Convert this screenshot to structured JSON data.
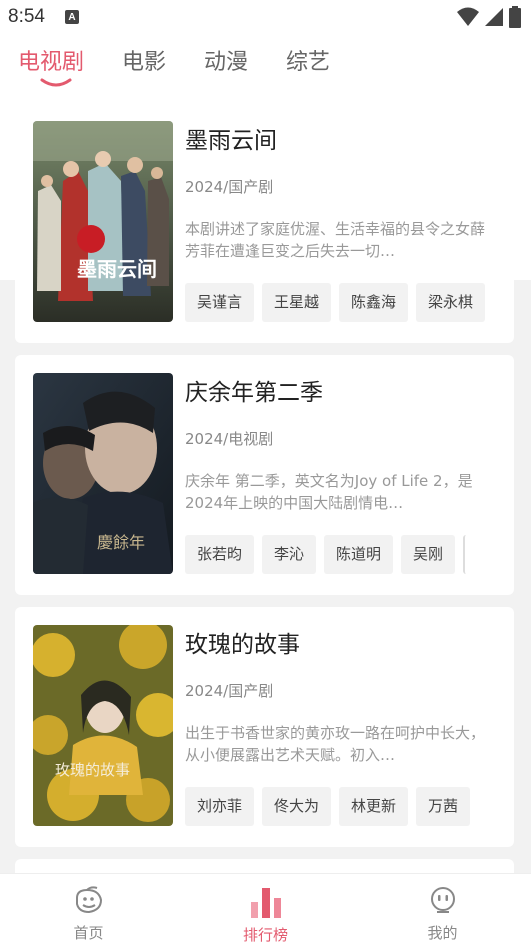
{
  "status_bar": {
    "time": "8:54",
    "notification_icon": "A"
  },
  "tabs": [
    {
      "label": "电视剧",
      "active": true
    },
    {
      "label": "电影",
      "active": false
    },
    {
      "label": "动漫",
      "active": false
    },
    {
      "label": "综艺",
      "active": false
    }
  ],
  "shows": [
    {
      "title": "墨雨云间",
      "meta": "2024/国产剧",
      "desc": "本剧讲述了家庭优渥、生活幸福的县令之女薛芳菲在遭逢巨变之后失去一切…",
      "cast": [
        "吴谨言",
        "王星越",
        "陈鑫海",
        "梁永棋"
      ],
      "poster_text": "墨雨云间"
    },
    {
      "title": "庆余年第二季",
      "meta": "2024/电视剧",
      "desc": "庆余年 第二季，英文名为Joy of Life 2，是2024年上映的中国大陆剧情电…",
      "cast": [
        "张若昀",
        "李沁",
        "陈道明",
        "吴刚",
        ""
      ],
      "poster_text": "慶餘年"
    },
    {
      "title": "玫瑰的故事",
      "meta": "2024/国产剧",
      "desc": "出生于书香世家的黄亦玫一路在呵护中长大，从小便展露出艺术天赋。初入…",
      "cast": [
        "刘亦菲",
        "佟大为",
        "林更新",
        "万茜"
      ],
      "poster_text": "玫瑰的故事"
    }
  ],
  "bottom_nav": [
    {
      "label": "首页",
      "icon": "home-bird-icon",
      "active": false
    },
    {
      "label": "排行榜",
      "icon": "ranking-bars-icon",
      "active": true
    },
    {
      "label": "我的",
      "icon": "profile-face-icon",
      "active": false
    }
  ],
  "colors": {
    "accent": "#e35a6e",
    "background": "#f2f2f2",
    "card": "#ffffff"
  }
}
